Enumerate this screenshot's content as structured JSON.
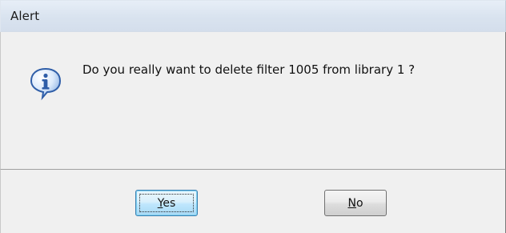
{
  "window": {
    "title": "Alert"
  },
  "message": {
    "text": "Do you really want to delete filter 1005 from library 1 ?"
  },
  "buttons": {
    "yes": {
      "mnemonic": "Y",
      "rest": "es"
    },
    "no": {
      "mnemonic": "N",
      "rest": "o"
    }
  },
  "icons": {
    "info": "info-icon"
  },
  "colors": {
    "titlebar": "#d9e3ef",
    "client_background": "#f0f0f0",
    "default_button_border": "#3c7fb1",
    "info_icon_blue": "#2f5ea8"
  }
}
